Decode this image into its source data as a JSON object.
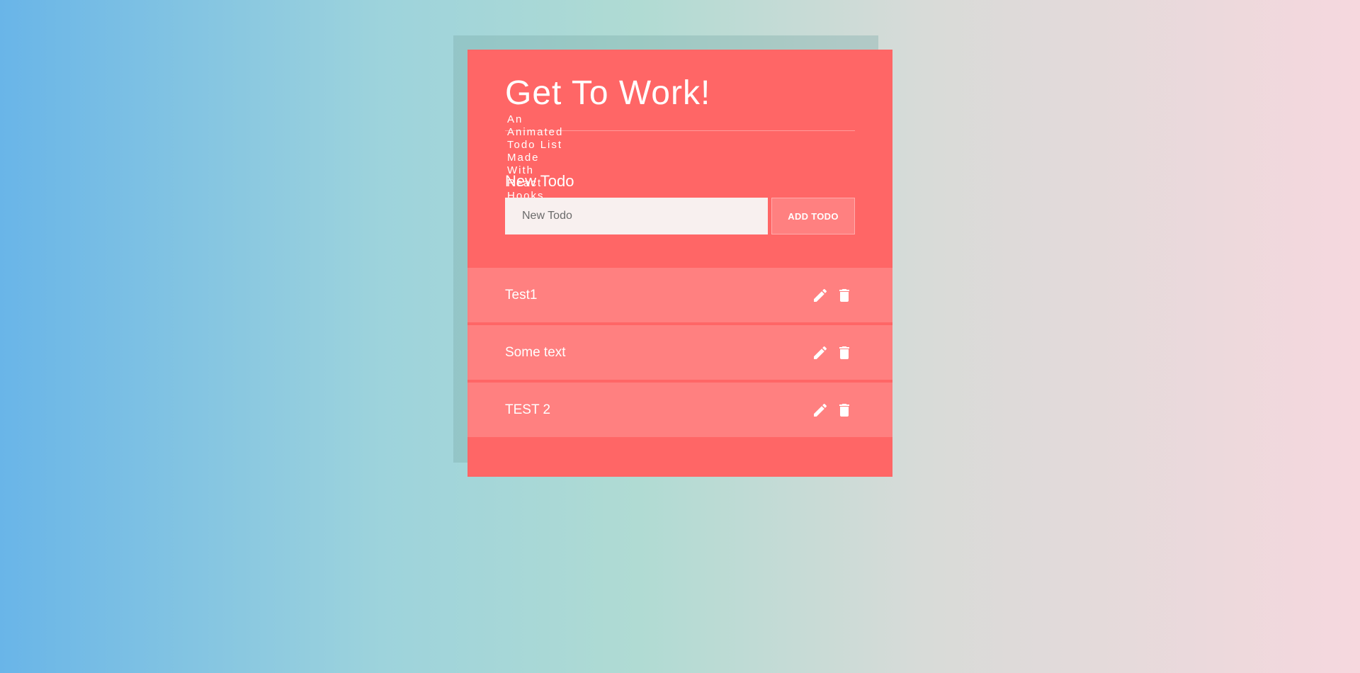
{
  "app": {
    "title": "Get To Work!",
    "subtitle": "An Animated Todo List Made With React Hooks"
  },
  "form": {
    "label": "New Todo",
    "input_placeholder": "New Todo",
    "input_value": "",
    "add_button_label": "ADD TODO"
  },
  "todos": [
    {
      "text": "Test1",
      "edit_icon": "pencil-icon",
      "delete_icon": "trash-icon"
    },
    {
      "text": "Some text",
      "edit_icon": "pencil-icon",
      "delete_icon": "trash-icon"
    },
    {
      "text": "TEST 2",
      "edit_icon": "pencil-icon",
      "delete_icon": "trash-icon"
    }
  ],
  "colors": {
    "card": "#ff6666",
    "todo_item": "#ff8080",
    "input_bg": "#f8f0ef",
    "text": "#ffffff"
  }
}
